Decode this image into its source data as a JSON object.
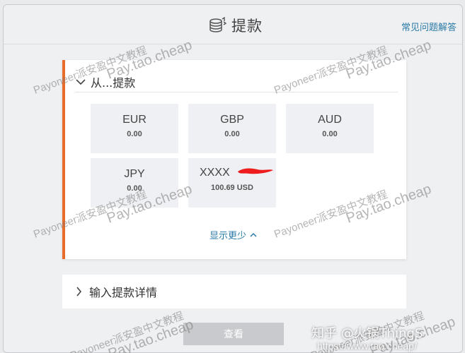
{
  "header": {
    "title": "提款",
    "faq_link": "常见问题解答"
  },
  "source_card": {
    "heading": "从...提款",
    "balances": [
      {
        "currency": "EUR",
        "amount": "0.00"
      },
      {
        "currency": "GBP",
        "amount": "0.00"
      },
      {
        "currency": "AUD",
        "amount": "0.00"
      },
      {
        "currency": "JPY",
        "amount": "0.00"
      },
      {
        "currency": "XXXX",
        "amount": "100.69 USD"
      }
    ],
    "show_less": "显示更少"
  },
  "details_section": {
    "label": "输入提款详情"
  },
  "actions": {
    "view_label": "查看"
  },
  "watermarks": {
    "line_cn": "Payoneer派安盈中文教程",
    "line_url": "Pay.tao.cheap"
  },
  "footer_overlay": {
    "zhihu": "知乎 @火锅ThingS",
    "url": "https://www.tao.cheap/"
  },
  "colors": {
    "accent": "#e86c2c",
    "link": "#2a7aa8",
    "button_disabled": "#c9cacd",
    "redaction": "#ee1c1c"
  },
  "icons": {
    "title_icon": "coins-icon",
    "collapse_icon": "chevron-down-icon",
    "expand_icon": "chevron-right-icon",
    "show_less_icon": "chevron-up-icon"
  }
}
